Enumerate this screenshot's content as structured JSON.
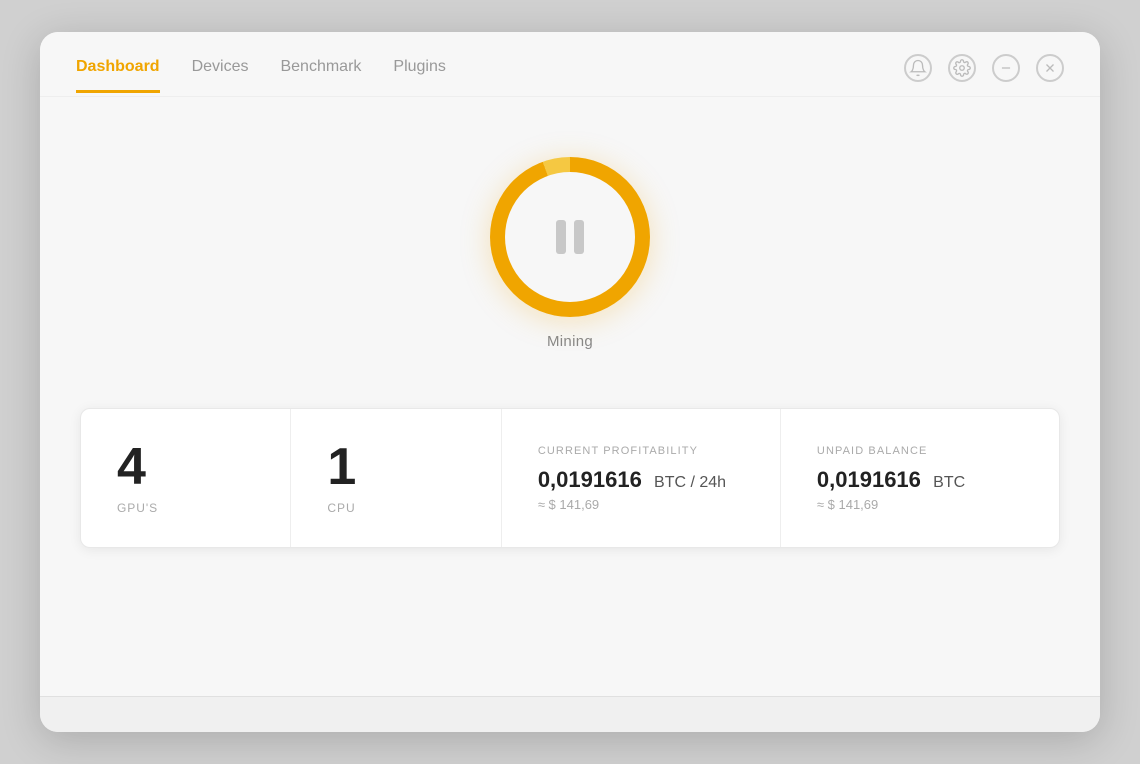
{
  "nav": {
    "items": [
      {
        "label": "Dashboard",
        "active": true
      },
      {
        "label": "Devices",
        "active": false
      },
      {
        "label": "Benchmark",
        "active": false
      },
      {
        "label": "Plugins",
        "active": false
      }
    ]
  },
  "window_controls": {
    "bell_title": "Notifications",
    "gear_title": "Settings",
    "minimize_title": "Minimize",
    "close_title": "Close"
  },
  "mining": {
    "button_label": "Mining"
  },
  "stats": {
    "gpu_count": "4",
    "gpu_label": "GPU'S",
    "cpu_count": "1",
    "cpu_label": "CPU",
    "profitability_header": "CURRENT PROFITABILITY",
    "profitability_btc": "0,0191616",
    "profitability_unit": "BTC / 24h",
    "profitability_usd": "≈ $ 141,69",
    "balance_header": "UNPAID BALANCE",
    "balance_btc": "0,0191616",
    "balance_unit": "BTC",
    "balance_usd": "≈ $ 141,69"
  }
}
